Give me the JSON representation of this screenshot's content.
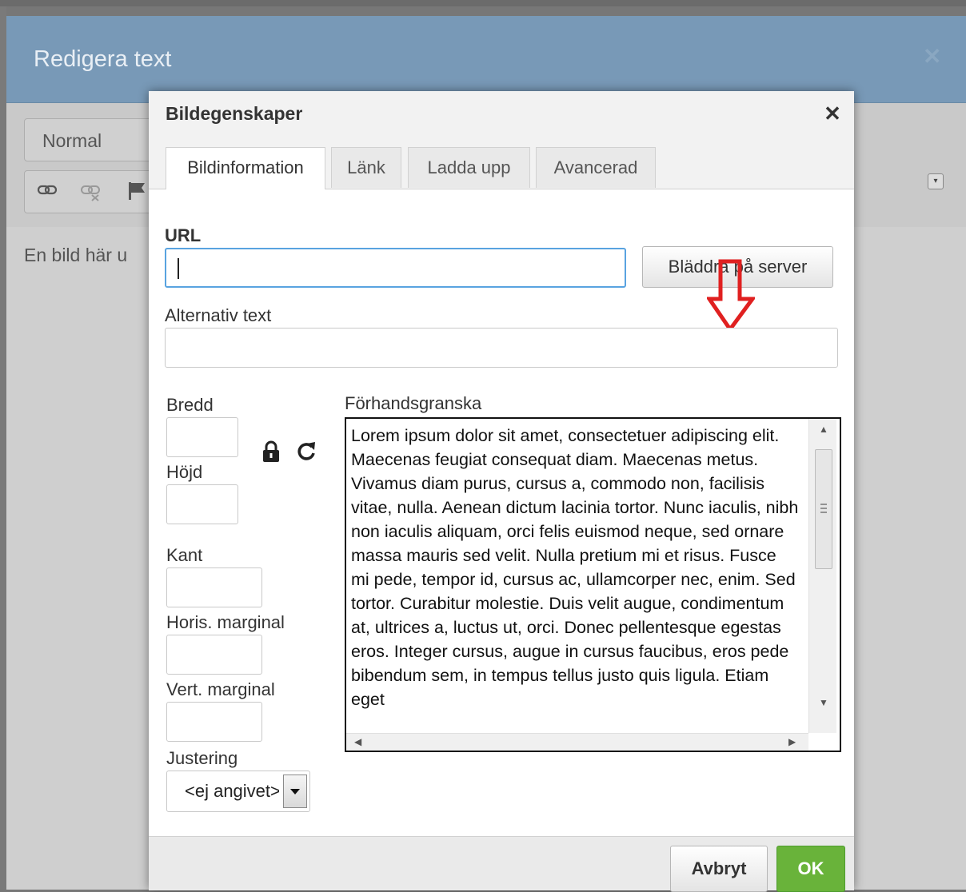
{
  "editor": {
    "title": "Redigera text",
    "close_glyph": "✕",
    "format_value": "Normal",
    "content_text": "En bild här u",
    "toolbar_icons": [
      "link-icon",
      "unlink-icon",
      "anchor-flag-icon"
    ]
  },
  "dialog": {
    "title": "Bildegenskaper",
    "close_glyph": "✕",
    "tabs": [
      {
        "label": "Bildinformation",
        "active": true
      },
      {
        "label": "Länk",
        "active": false
      },
      {
        "label": "Ladda upp",
        "active": false
      },
      {
        "label": "Avancerad",
        "active": false
      }
    ],
    "url_label": "URL",
    "url_value": "",
    "browse_label": "Bläddra på server",
    "alt_label": "Alternativ text",
    "alt_value": "",
    "width_label": "Bredd",
    "height_label": "Höjd",
    "border_label": "Kant",
    "hspace_label": "Horis. marginal",
    "vspace_label": "Vert. marginal",
    "align_label": "Justering",
    "align_value": "<ej angivet>",
    "preview_label": "Förhandsgranska",
    "preview_text": "Lorem ipsum dolor sit amet, consectetuer adipiscing elit. Maecenas feugiat consequat diam. Maecenas metus. Vivamus diam purus, cursus a, commodo non, facilisis vitae, nulla. Aenean dictum lacinia tortor. Nunc iaculis, nibh non iaculis aliquam, orci felis euismod neque, sed ornare massa mauris sed velit. Nulla pretium mi et risus. Fusce mi pede, tempor id, cursus ac, ullamcorper nec, enim. Sed tortor. Curabitur molestie. Duis velit augue, condimentum at, ultrices a, luctus ut, orci. Donec pellentesque egestas eros. Integer cursus, augue in cursus faucibus, eros pede bibendum sem, in tempus tellus justo quis ligula. Etiam eget",
    "cancel_label": "Avbryt",
    "ok_label": "OK"
  },
  "colors": {
    "header_blue": "#7899b7",
    "ok_green": "#69b33a",
    "annotation_red": "#e02020",
    "focus_blue": "#59a3e0"
  }
}
